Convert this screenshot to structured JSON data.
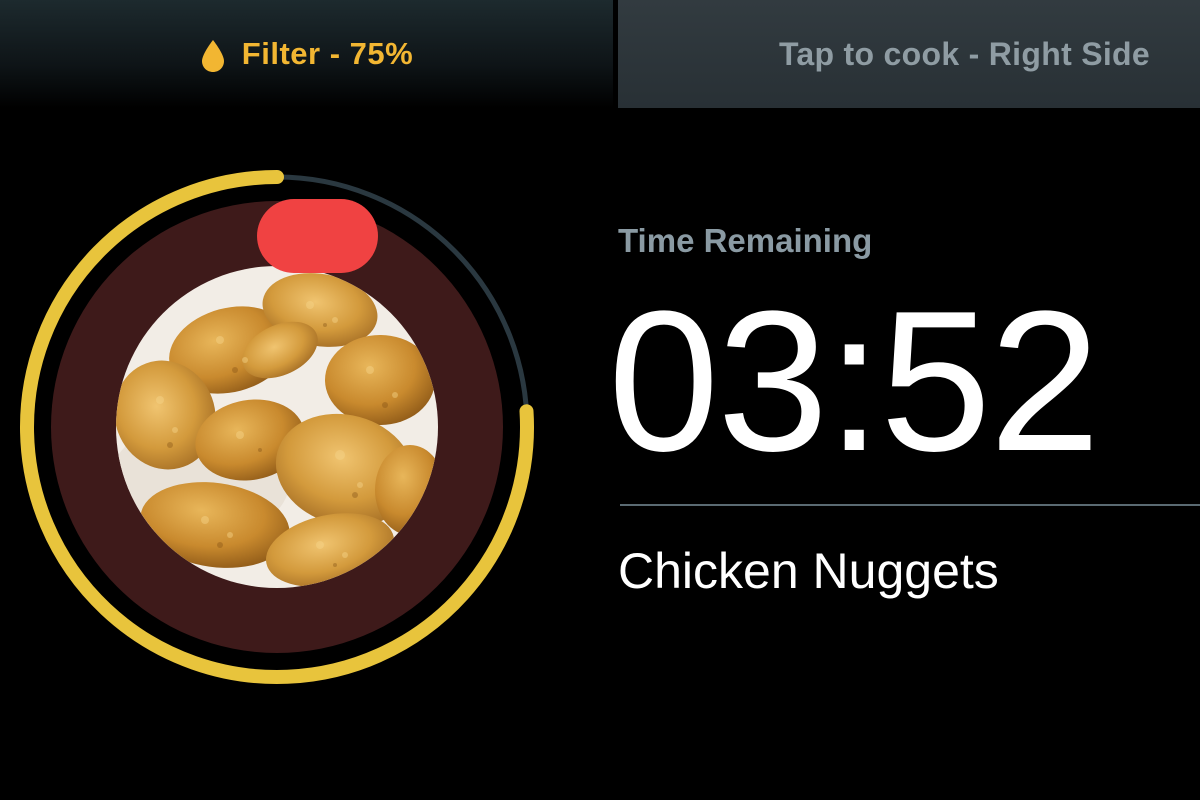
{
  "header": {
    "filter_label": "Filter - 75%",
    "filter_icon": "drop-icon",
    "tap_to_cook_label": "Tap to cook - Right Side"
  },
  "cook_progress": {
    "progress_fraction": 0.76,
    "ring_color": "#e8c43c",
    "track_color": "#2a3840",
    "inner_bg_color": "#3e1a1a",
    "indicator_color": "#f04242",
    "food_image": "chicken-nuggets-photo"
  },
  "timer": {
    "label": "Time Remaining",
    "value": "03:52"
  },
  "food": {
    "name": "Chicken Nuggets"
  },
  "colors": {
    "filter_accent": "#f2b632",
    "secondary_text": "#8a9aa3"
  }
}
